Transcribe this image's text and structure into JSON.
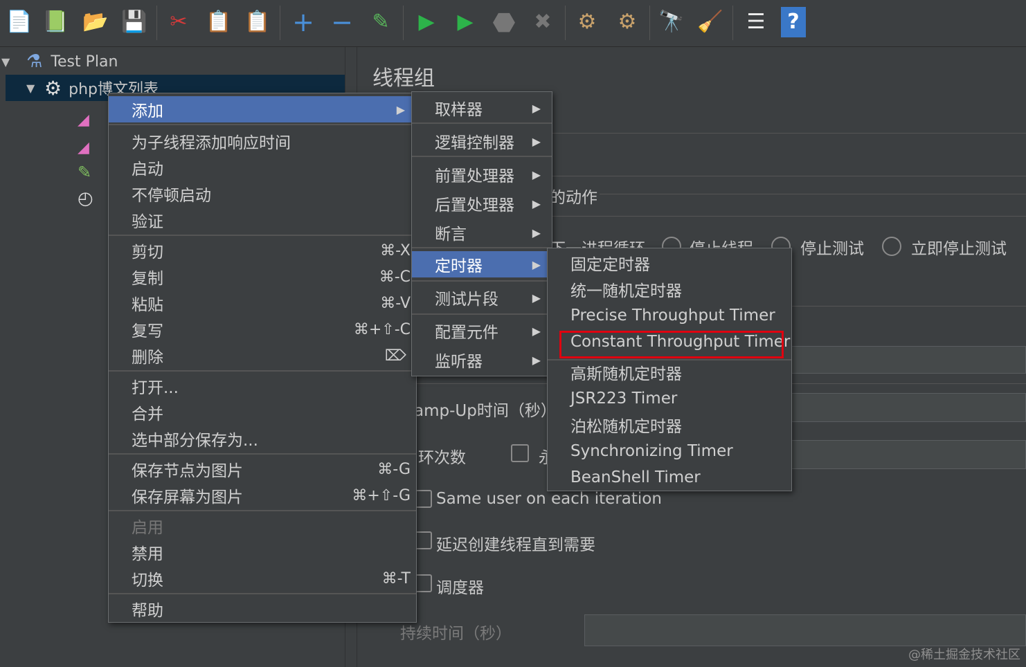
{
  "toolbar": {
    "icons": [
      {
        "name": "new-icon",
        "glyph": "📄"
      },
      {
        "name": "templates-icon",
        "glyph": "📗"
      },
      {
        "name": "open-icon",
        "glyph": "📂"
      },
      {
        "name": "save-icon",
        "glyph": "💾"
      },
      {
        "name": "cut-icon",
        "glyph": "✂"
      },
      {
        "name": "copy-icon",
        "glyph": "📋"
      },
      {
        "name": "paste-icon",
        "glyph": "📋"
      },
      {
        "name": "expand-icon",
        "glyph": "+"
      },
      {
        "name": "collapse-icon",
        "glyph": "−"
      },
      {
        "name": "toggle-icon",
        "glyph": "✎"
      },
      {
        "name": "start-icon",
        "glyph": "▶"
      },
      {
        "name": "start-no-pause-icon",
        "glyph": "▶"
      },
      {
        "name": "stop-icon",
        "glyph": "⬣"
      },
      {
        "name": "shutdown-icon",
        "glyph": "✖"
      },
      {
        "name": "clear-icon",
        "glyph": "⚙"
      },
      {
        "name": "clear-all-icon",
        "glyph": "⚙"
      },
      {
        "name": "search-icon",
        "glyph": "🔭"
      },
      {
        "name": "reset-search-icon",
        "glyph": "🧹"
      },
      {
        "name": "function-helper-icon",
        "glyph": "☰"
      },
      {
        "name": "help-icon",
        "glyph": "?"
      }
    ]
  },
  "tree": {
    "root_label": "Test Plan",
    "thread_group_label": "php博文列表"
  },
  "panel": {
    "title": "线程组",
    "action_label_partial": "的动作",
    "radio_next_loop_partial": "下一进程循环",
    "radio_stop_thread": "停止线程",
    "radio_stop_test": "停止测试",
    "radio_stop_test_now": "立即停止测试",
    "rampup_label_partial": "amp-Up时间（秒）",
    "loop_label_partial": "环次数",
    "loop_forever_partial": "永",
    "same_user_label": "Same user on each iteration",
    "delay_label": "延迟创建线程直到需要",
    "scheduler_label": "调度器",
    "duration_label": "持续时间（秒）"
  },
  "context_menu": {
    "items": [
      {
        "label": "添加",
        "submenu": true,
        "active": true
      },
      {
        "label": "为子线程添加响应时间"
      },
      {
        "label": "启动"
      },
      {
        "label": "不停顿启动"
      },
      {
        "label": "验证"
      },
      {
        "label": "剪切",
        "shortcut": "⌘-X"
      },
      {
        "label": "复制",
        "shortcut": "⌘-C"
      },
      {
        "label": "粘贴",
        "shortcut": "⌘-V"
      },
      {
        "label": "复写",
        "shortcut": "⌘+⇧-C"
      },
      {
        "label": "删除",
        "shortcut": "⌦"
      },
      {
        "label": "打开..."
      },
      {
        "label": "合并"
      },
      {
        "label": "选中部分保存为..."
      },
      {
        "label": "保存节点为图片",
        "shortcut": "⌘-G"
      },
      {
        "label": "保存屏幕为图片",
        "shortcut": "⌘+⇧-G"
      },
      {
        "label": "启用",
        "disabled": true
      },
      {
        "label": "禁用"
      },
      {
        "label": "切换",
        "shortcut": "⌘-T"
      },
      {
        "label": "帮助"
      }
    ]
  },
  "add_submenu": {
    "items": [
      {
        "label": "取样器"
      },
      {
        "label": "逻辑控制器"
      },
      {
        "label": "前置处理器"
      },
      {
        "label": "后置处理器"
      },
      {
        "label": "断言"
      },
      {
        "label": "定时器",
        "active": true
      },
      {
        "label": "测试片段"
      },
      {
        "label": "配置元件"
      },
      {
        "label": "监听器"
      }
    ]
  },
  "timer_submenu": {
    "items": [
      {
        "label": "固定定时器"
      },
      {
        "label": "统一随机定时器"
      },
      {
        "label": "Precise Throughput Timer"
      },
      {
        "label": "Constant Throughput Timer",
        "highlighted": true
      },
      {
        "label": "高斯随机定时器"
      },
      {
        "label": "JSR223 Timer"
      },
      {
        "label": "泊松随机定时器"
      },
      {
        "label": "Synchronizing Timer"
      },
      {
        "label": "BeanShell Timer"
      }
    ]
  },
  "watermark": "@稀土掘金技术社区",
  "colors": {
    "background": "#3c3f41",
    "menu_active": "#4b6eaf",
    "tree_selection": "#0d293e",
    "highlight_border": "#e0000f"
  }
}
